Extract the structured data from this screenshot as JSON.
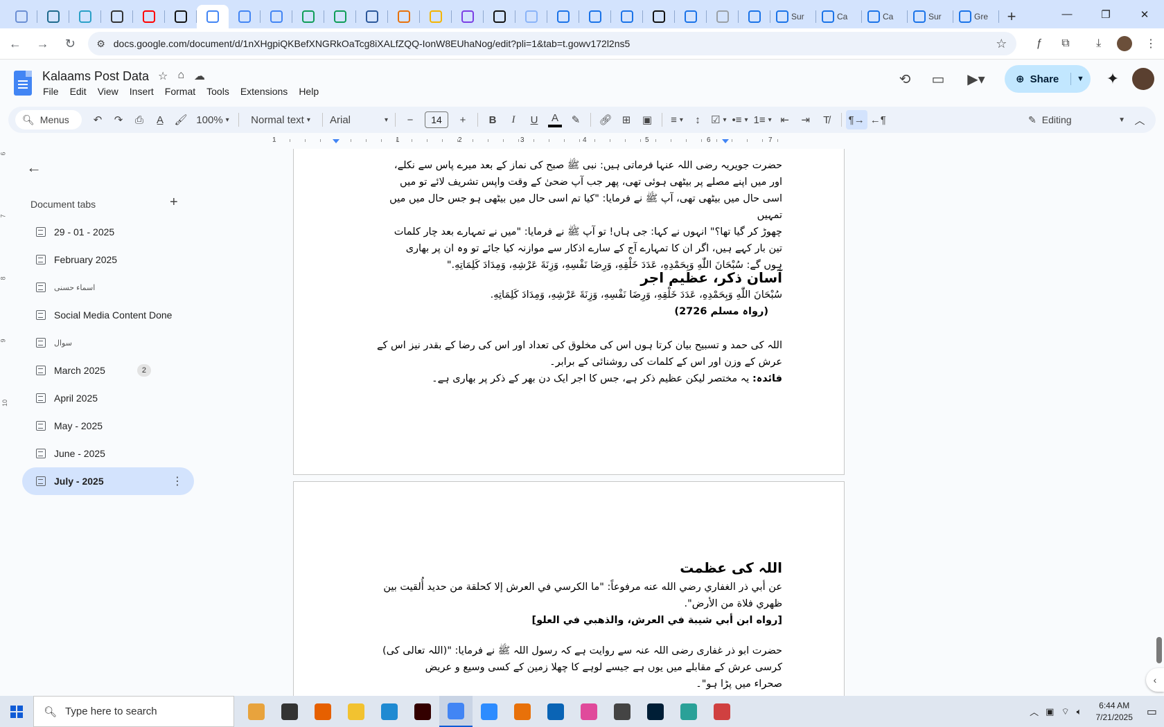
{
  "browser": {
    "tabs": [
      {
        "icon": "globe-half-icon",
        "color": "#6b8fd4",
        "label": ""
      },
      {
        "icon": "wordpress-icon",
        "color": "#1e6a8d",
        "label": ""
      },
      {
        "icon": "arrow-app-icon",
        "color": "#2aa0c7",
        "label": ""
      },
      {
        "icon": "chatgpt-icon",
        "color": "#333333",
        "label": ""
      },
      {
        "icon": "youtube-icon",
        "color": "#ff0000",
        "label": ""
      },
      {
        "icon": "lightning-app-icon",
        "color": "#111111",
        "label": ""
      },
      {
        "icon": "google-docs-icon",
        "color": "#4285f4",
        "label": "",
        "active": true
      },
      {
        "icon": "google-docs-icon",
        "color": "#4285f4",
        "label": ""
      },
      {
        "icon": "google-docs-icon",
        "color": "#4285f4",
        "label": ""
      },
      {
        "icon": "google-sheets-icon",
        "color": "#0f9d58",
        "label": ""
      },
      {
        "icon": "google-sheets-icon",
        "color": "#0f9d58",
        "label": ""
      },
      {
        "icon": "word-icon",
        "color": "#2b579a",
        "label": ""
      },
      {
        "icon": "orange-app-icon",
        "color": "#e8710a",
        "label": ""
      },
      {
        "icon": "bookmark-app-icon",
        "color": "#f4b400",
        "label": ""
      },
      {
        "icon": "code-braces-icon",
        "color": "#7b3fe4",
        "label": ""
      },
      {
        "icon": "black-a-icon",
        "color": "#111111",
        "label": ""
      },
      {
        "icon": "grid-app-icon",
        "color": "#8ab4f8",
        "label": ""
      },
      {
        "icon": "forms-icon",
        "color": "#1a73e8",
        "label": ""
      },
      {
        "icon": "forms-icon",
        "color": "#1a73e8",
        "label": ""
      },
      {
        "icon": "forms-icon",
        "color": "#1a73e8",
        "label": ""
      },
      {
        "icon": "m-app-icon",
        "color": "#111111",
        "label": ""
      },
      {
        "icon": "forms-icon",
        "color": "#1a73e8",
        "label": ""
      },
      {
        "icon": "grey-globe-icon",
        "color": "#9aa0a6",
        "label": ""
      },
      {
        "icon": "forms-icon",
        "color": "#1a73e8",
        "label": ""
      },
      {
        "icon": "forms-icon",
        "color": "#1a73e8",
        "label": "Sur",
        "wide": true
      },
      {
        "icon": "forms-icon",
        "color": "#1a73e8",
        "label": "Ca",
        "wide": true
      },
      {
        "icon": "forms-icon",
        "color": "#1a73e8",
        "label": "Ca",
        "wide": true
      },
      {
        "icon": "forms-icon",
        "color": "#1a73e8",
        "label": "Sur",
        "wide": true
      },
      {
        "icon": "forms-icon",
        "color": "#1a73e8",
        "label": "Gre",
        "wide": true
      }
    ],
    "new_tab": "+",
    "url": "docs.google.com/document/d/1nXHgpiQKBefXNGRkOaTcg8iXALfZQQ-IonW8EUhaNog/edit?pli=1&tab=t.gowv172l2ns5"
  },
  "docs": {
    "title": "Kalaams Post Data",
    "menu": [
      "File",
      "Edit",
      "View",
      "Insert",
      "Format",
      "Tools",
      "Extensions",
      "Help"
    ],
    "share_label": "Share",
    "toolbar": {
      "menus_label": "Menus",
      "zoom": "100%",
      "style": "Normal text",
      "font": "Arial",
      "font_size": "14",
      "mode": "Editing"
    },
    "ruler_numbers": [
      "1",
      "1",
      "2",
      "3",
      "4",
      "5",
      "6",
      "7"
    ],
    "vruler_numbers": [
      "6",
      "7",
      "8",
      "9",
      "10"
    ]
  },
  "sidebar": {
    "heading": "Document tabs",
    "tabs": [
      {
        "label": "29 - 01 - 2025"
      },
      {
        "label": "February 2025"
      },
      {
        "label": "اسماء حسنی",
        "small": true
      },
      {
        "label": "Social Media Content Done"
      },
      {
        "label": "سوال",
        "small": true
      },
      {
        "label": "March 2025",
        "badge": "2"
      },
      {
        "label": "April 2025"
      },
      {
        "label": "May - 2025"
      },
      {
        "label": "June - 2025"
      },
      {
        "label": "July - 2025",
        "selected": true
      }
    ]
  },
  "content": {
    "p1": [
      "حضرت جویریہ رضی اللہ عنہا فرماتی ہیں: نبی ﷺ صبح کی نماز کے بعد میرے پاس سے نکلے،",
      "اور میں اپنے مصلے پر بیٹھی ہوئی تھی، پھر جب آپ ضحیٰ کے وقت واپس تشریف لائے تو میں",
      "اسی حال میں بیٹھی تھی، آپ ﷺ نے فرمایا: \"کیا تم اسی حال میں بیٹھی ہو جس حال میں میں تمہیں",
      "چھوڑ کر گیا تھا؟\" انہوں نے کہا: جی ہاں! تو آپ ﷺ نے فرمایا: \"میں نے تمہارے بعد چار کلمات",
      "تین بار کہے ہیں، اگر ان کا تمہارے آج کے سارے اذکار سے موازنہ کیا جائے تو وہ ان پر بھاری",
      "ہوں گے: سُبْحَانَ اللّٰهِ وَبِحَمْدِهِ، عَدَدَ خَلْقِهِ، وَرِضَا نَفْسِهِ، وَزِنَةَ عَرْشِهِ، وَمِدَادَ كَلِمَاتِهِ.\""
    ],
    "h1": "آسان ذکر، عظیم اجر",
    "p2": "سُبْحَانَ اللّٰهِ وَبِحَمْدِهِ، عَدَدَ خَلْقِهِ، وَرِضَا نَفْسِهِ، وَزِنَةَ عَرْشِهِ، وَمِدَادَ كَلِمَاتِهِ.",
    "ref1": "(رواہ مسلم 2726)",
    "p3": [
      "اللہ کی حمد و تسبیح بیان کرتا ہوں اس کی مخلوق کی تعداد اور اس کی رضا کے بقدر نیز اس کے",
      "عرش کے وزن اور اس کے کلمات کی روشنائی کے برابر۔"
    ],
    "faida_label": "فائدہ:",
    "faida_text": " یہ مختصر لیکن عظیم ذکر ہے، جس کا اجر ایک دن بھر کے ذکر پر بھاری ہے۔",
    "h2": "اللہ کی عظمت",
    "p4": [
      "عن أبي ذر الغفاري رضي الله عنه مرفوعاً: \"ما الكرسي في العرش إلا كحلقة من حديد أُلقيت بين",
      "ظهري فلاة من الأرض\"."
    ],
    "ref2": "[رواه ابن أبي شيبة في العرش، والذهبي في العلو]",
    "p5": [
      "حضرت ابو ذر غفاری رضی اللہ عنہ سے روایت ہے کہ رسول اللہ ﷺ نے فرمایا: \"(اللہ تعالی کی)",
      "کرسی عرش کے مقابلے میں یوں ہے جیسے لوہے کا چھلا زمین کے کسی وسیع و عریض",
      "صحراء میں پڑا ہو\"۔"
    ]
  },
  "taskbar": {
    "search_placeholder": "Type here to search",
    "apps": [
      {
        "icon": "balloons-icon",
        "color": "#e8a33d"
      },
      {
        "icon": "task-view-icon",
        "color": "#333333"
      },
      {
        "icon": "firefox-icon",
        "color": "#e66000"
      },
      {
        "icon": "file-explorer-icon",
        "color": "#f2c230"
      },
      {
        "icon": "vscode-icon",
        "color": "#1f8ad2"
      },
      {
        "icon": "illustrator-icon",
        "color": "#330000"
      },
      {
        "icon": "chrome-icon",
        "color": "#4285f4",
        "active": true
      },
      {
        "icon": "zoom-icon",
        "color": "#2d8cff"
      },
      {
        "icon": "orange-app-icon",
        "color": "#e8710a"
      },
      {
        "icon": "outlook-icon",
        "color": "#0a64b5"
      },
      {
        "icon": "gradient-app-icon",
        "color": "#e04a9b"
      },
      {
        "icon": "pen-tool-icon",
        "color": "#444444"
      },
      {
        "icon": "photoshop-icon",
        "color": "#001e36"
      },
      {
        "icon": "diamond-app-icon",
        "color": "#2aa198"
      },
      {
        "icon": "snipping-tool-icon",
        "color": "#d04040"
      }
    ],
    "time": "6:44 AM",
    "date": "7/21/2025"
  }
}
